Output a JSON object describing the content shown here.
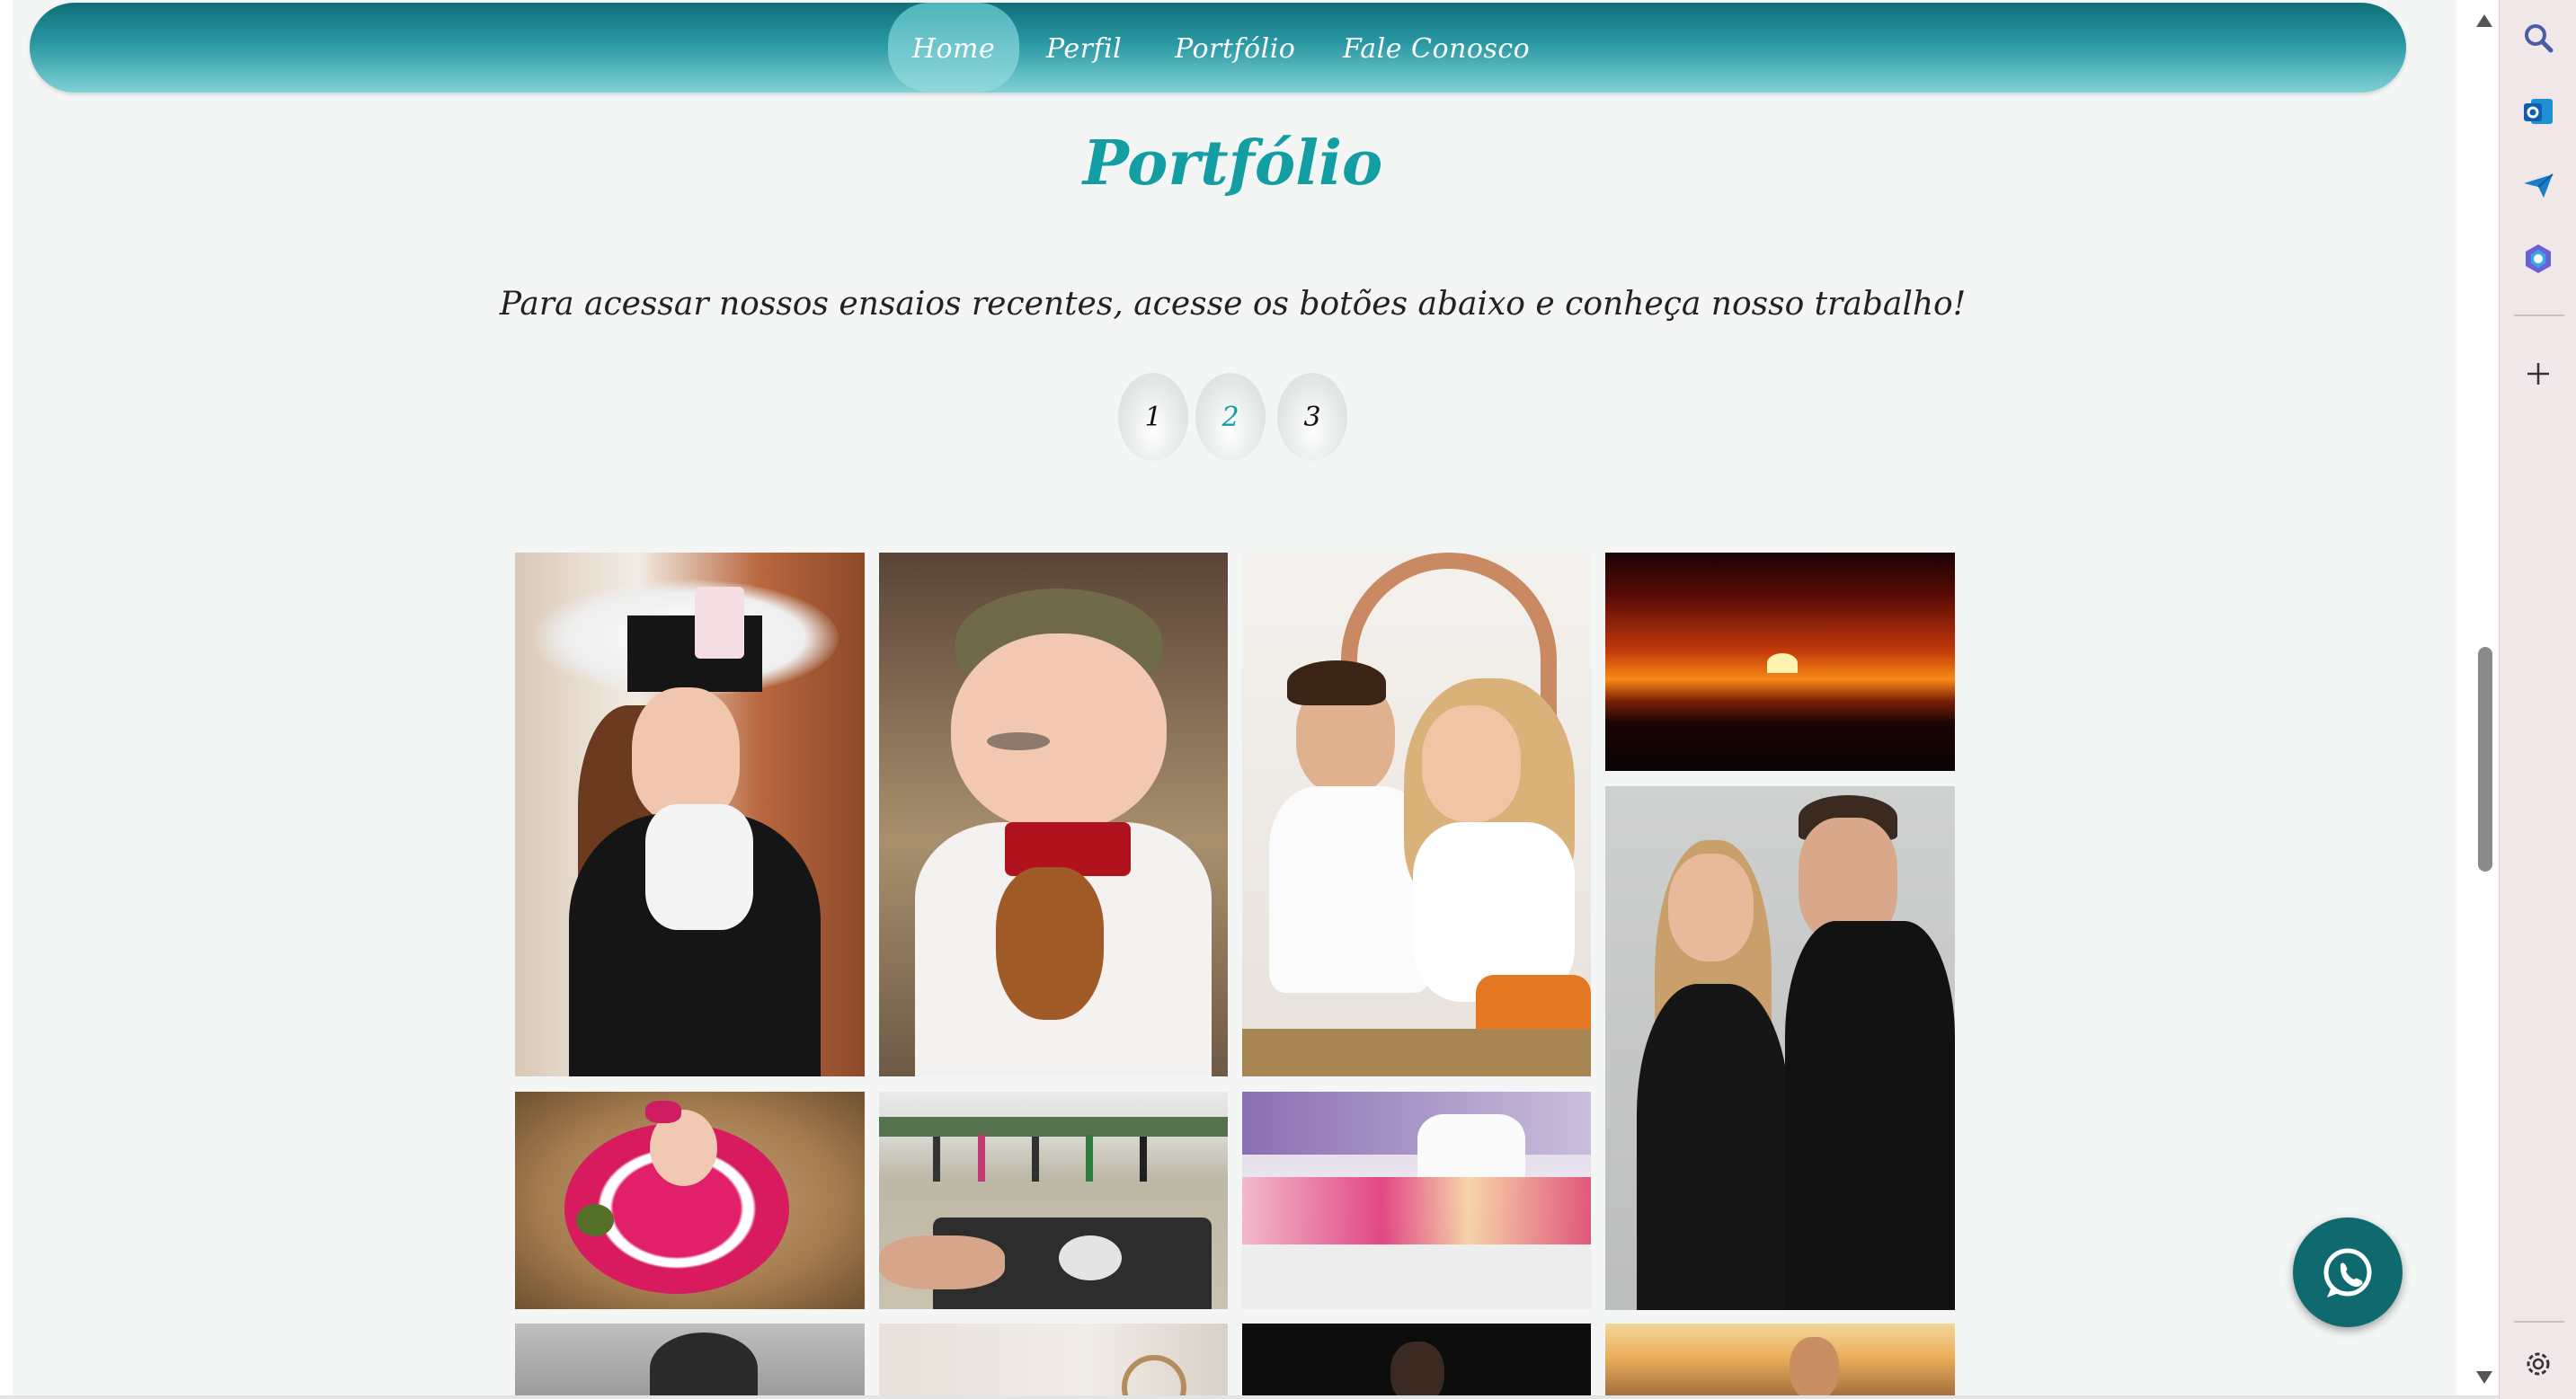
{
  "nav": {
    "items": [
      "Home",
      "Perfil",
      "Portfólio",
      "Fale Conosco"
    ],
    "active": "Home"
  },
  "main": {
    "title": "Portfólio",
    "subtitle": "Para acessar nossos ensaios recentes, acesse os botões abaixo e conheça nosso trabalho!",
    "pagination": [
      "1",
      "2",
      "3"
    ],
    "current_page": "2"
  },
  "gallery": {
    "photos": [
      "graduation-portrait",
      "baby-with-chimarrao",
      "mother-and-son",
      "sunset-over-mountains",
      "couple-pregnancy-portrait",
      "baby-in-red-dress",
      "outdoor-dance-class-dj",
      "decorated-party-table",
      "black-and-white-portrait",
      "light-studio-photo",
      "dark-studio-portrait",
      "woman-at-golden-hour-beach"
    ]
  },
  "colors": {
    "accent": "#139ea3",
    "nav_dark": "#0e6f78",
    "nav_light": "#7fd1d6",
    "whatsapp": "#0e6a6e",
    "background": "#f4f6f5"
  },
  "floating": {
    "icon": "whatsapp-icon"
  },
  "sidebar": {
    "icons": [
      "search-icon",
      "outlook-icon",
      "send-icon",
      "copilot-icon",
      "add-icon",
      "settings-icon"
    ]
  }
}
